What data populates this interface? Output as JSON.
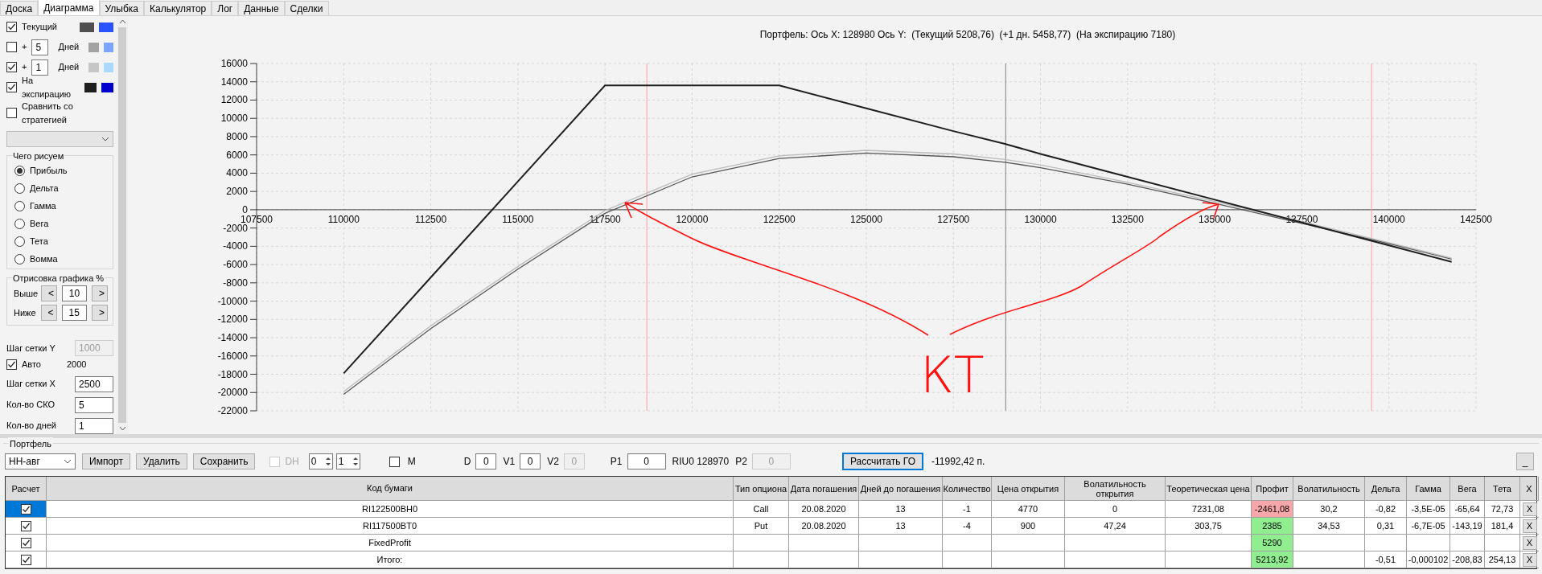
{
  "tabs": [
    {
      "label": "Доска",
      "selected": false
    },
    {
      "label": "Диаграмма",
      "selected": true
    },
    {
      "label": "Улыбка",
      "selected": false
    },
    {
      "label": "Калькулятор",
      "selected": false
    },
    {
      "label": "Лог",
      "selected": false
    },
    {
      "label": "Данные",
      "selected": false
    },
    {
      "label": "Сделки",
      "selected": false
    }
  ],
  "settings": {
    "series": [
      {
        "kind": "plain",
        "label": "Текущий",
        "checked": true,
        "swatches": [
          {
            "color": "#4f4f4f"
          },
          {
            "color": "#2a52ff"
          }
        ]
      },
      {
        "kind": "days",
        "prefix": "+",
        "days": "5",
        "label": "Дней",
        "checked": false,
        "swatches": [
          {
            "color": "#a3a3a3"
          },
          {
            "color": "#7aa6ff"
          }
        ]
      },
      {
        "kind": "days",
        "prefix": "+",
        "days": "1",
        "label": "Дней",
        "checked": true,
        "swatches": [
          {
            "color": "#c6c6c6"
          },
          {
            "color": "#a9d9ff"
          }
        ]
      },
      {
        "kind": "plain",
        "label": "На экспирацию",
        "checked": true,
        "swatches": [
          {
            "color": "#1e1e1e"
          },
          {
            "color": "#0000cc"
          }
        ]
      }
    ],
    "compare": {
      "label": "Сравнить со стратегией",
      "checked": false
    },
    "what_to_draw": {
      "title": "Чего рисуем",
      "options": [
        {
          "label": "Прибыль",
          "selected": true
        },
        {
          "label": "Дельта",
          "selected": false
        },
        {
          "label": "Гамма",
          "selected": false
        },
        {
          "label": "Вега",
          "selected": false
        },
        {
          "label": "Тета",
          "selected": false
        },
        {
          "label": "Вомма",
          "selected": false
        }
      ]
    },
    "range": {
      "title": "Отрисовка графика %",
      "rows": [
        {
          "label": "Выше",
          "value": "10",
          "dec": "<",
          "inc": ">"
        },
        {
          "label": "Ниже",
          "value": "15",
          "dec": "<",
          "inc": ">"
        }
      ]
    },
    "grid_y": {
      "label": "Шаг сетки Y",
      "value": "1000",
      "disabled": true
    },
    "auto": {
      "label": "Авто",
      "checked": true,
      "value": "2000"
    },
    "grid_x": {
      "label": "Шаг сетки X",
      "value": "2500"
    },
    "sko": {
      "label": "Кол-во СКО",
      "value": "5"
    },
    "days": {
      "label": "Кол-во дней",
      "value": "1"
    }
  },
  "chart": {
    "title": "Портфель: Ось X: 128980 Ось Y:  (Текущий 5208,76)  (+1 дн. 5458,77)  (На экспирацию 7180)",
    "handwritten_note": "КТ",
    "chart_data": {
      "type": "line",
      "x": [
        110000,
        112500,
        115000,
        117500,
        120000,
        122500,
        125000,
        127500,
        128980,
        130000,
        132500,
        135000,
        137500,
        140000,
        141800
      ],
      "series": [
        {
          "color": "#555555",
          "values": [
            -20200,
            -13000,
            -6500,
            -400,
            3600,
            5600,
            6200,
            5800,
            5200,
            4600,
            2800,
            700,
            -1500,
            -3700,
            -5400
          ]
        },
        {
          "color": "#bbbbbb",
          "values": [
            -19900,
            -12700,
            -6200,
            -100,
            3900,
            5900,
            6500,
            6100,
            5500,
            4900,
            3000,
            900,
            -1300,
            -3600,
            -5300
          ]
        },
        {
          "color": "#1e1e1e",
          "values": [
            -17900,
            -7400,
            3100,
            13600,
            13600,
            13600,
            11100,
            8600,
            7200,
            6100,
            3600,
            1100,
            -1400,
            -3900,
            -5700
          ]
        }
      ],
      "xlim": [
        107500,
        142500
      ],
      "ylim": [
        -22000,
        16000
      ],
      "xticks": [
        107500,
        110000,
        112500,
        115000,
        117500,
        120000,
        122500,
        125000,
        127500,
        130000,
        132500,
        135000,
        137500,
        140000,
        142500
      ],
      "yticks": [
        16000,
        14000,
        12000,
        10000,
        8000,
        6000,
        4000,
        2000,
        0,
        -2000,
        -4000,
        -6000,
        -8000,
        -10000,
        -12000,
        -14000,
        -16000,
        -18000,
        -20000,
        -22000
      ],
      "grid": true,
      "ref_lines": [
        {
          "axis": "x",
          "value": 118700,
          "color": "#ff9ea0"
        },
        {
          "axis": "x",
          "value": 139500,
          "color": "#ff9ea0"
        },
        {
          "axis": "x",
          "value": 129000,
          "color": "#808080"
        }
      ]
    }
  },
  "portfolio": {
    "title": "Портфель",
    "select": "НН-авг",
    "buttons": [
      "Импорт",
      "Удалить",
      "Сохранить"
    ],
    "dh": {
      "label": "DH",
      "checked": false,
      "disabled": true
    },
    "spinners": [
      "0",
      "1"
    ],
    "m": {
      "label": "M",
      "checked": false
    },
    "params": [
      {
        "kind": "field",
        "label": "D",
        "value": "0",
        "disabled": false
      },
      {
        "kind": "field",
        "label": "V1",
        "value": "0",
        "disabled": false
      },
      {
        "kind": "field",
        "label": "V2",
        "value": "0",
        "disabled": true
      },
      {
        "kind": "field",
        "label": "P1",
        "value": "0",
        "disabled": false
      },
      {
        "kind": "text",
        "label": "RIU0 128970"
      },
      {
        "kind": "field",
        "label": "P2",
        "value": "0",
        "disabled": true
      }
    ],
    "calc_button": "Рассчитать ГО",
    "margin": "-11992,42 п.",
    "minimize": "_"
  },
  "table": {
    "columns": [
      "Расчет",
      "Код бумаги",
      "Тип опциона",
      "Дата погашения",
      "Дней до погашения",
      "Количество",
      "Цена открытия",
      "Волатильность открытия",
      "Теоретическая цена",
      "Профит",
      "Волатильность",
      "Дельта",
      "Гамма",
      "Вега",
      "Тета",
      "X"
    ],
    "rows": [
      {
        "selected": true,
        "cells": [
          {
            "kind": "checkbox",
            "checked": true
          },
          "RI122500BH0",
          "Call",
          "20.08.2020",
          "13",
          "-1",
          "4770",
          "0",
          "7231,08",
          {
            "kind": "profit",
            "text": "-2461,08",
            "color": "#f7a6aa"
          },
          "30,2",
          "-0,82",
          "-3,5E-05",
          "-65,64",
          "72,73",
          {
            "kind": "button",
            "text": "X"
          }
        ]
      },
      {
        "selected": false,
        "cells": [
          {
            "kind": "checkbox",
            "checked": true
          },
          "RI117500BT0",
          "Put",
          "20.08.2020",
          "13",
          "-4",
          "900",
          "47,24",
          "303,75",
          {
            "kind": "profit",
            "text": "2385",
            "color": "#90ee90"
          },
          "34,53",
          "0,31",
          "-6,7E-05",
          "-143,19",
          "181,4",
          {
            "kind": "button",
            "text": "X"
          }
        ]
      },
      {
        "selected": false,
        "cells": [
          {
            "kind": "checkbox",
            "checked": true
          },
          "FixedProfit",
          "",
          "",
          "",
          "",
          "",
          "",
          "",
          {
            "kind": "profit",
            "text": "5290",
            "color": "#90ee90"
          },
          "",
          "",
          "",
          "",
          "",
          {
            "kind": "button",
            "text": "X"
          }
        ]
      },
      {
        "selected": false,
        "cells": [
          {
            "kind": "checkbox",
            "checked": true
          },
          "Итого:",
          "",
          "",
          "",
          "",
          "",
          "",
          "",
          {
            "kind": "profit",
            "text": "5213,92",
            "color": "#90ee90"
          },
          "",
          "-0,51",
          "-0,000102",
          "-208,83",
          "254,13",
          {
            "kind": "button",
            "text": "X"
          }
        ]
      }
    ]
  }
}
